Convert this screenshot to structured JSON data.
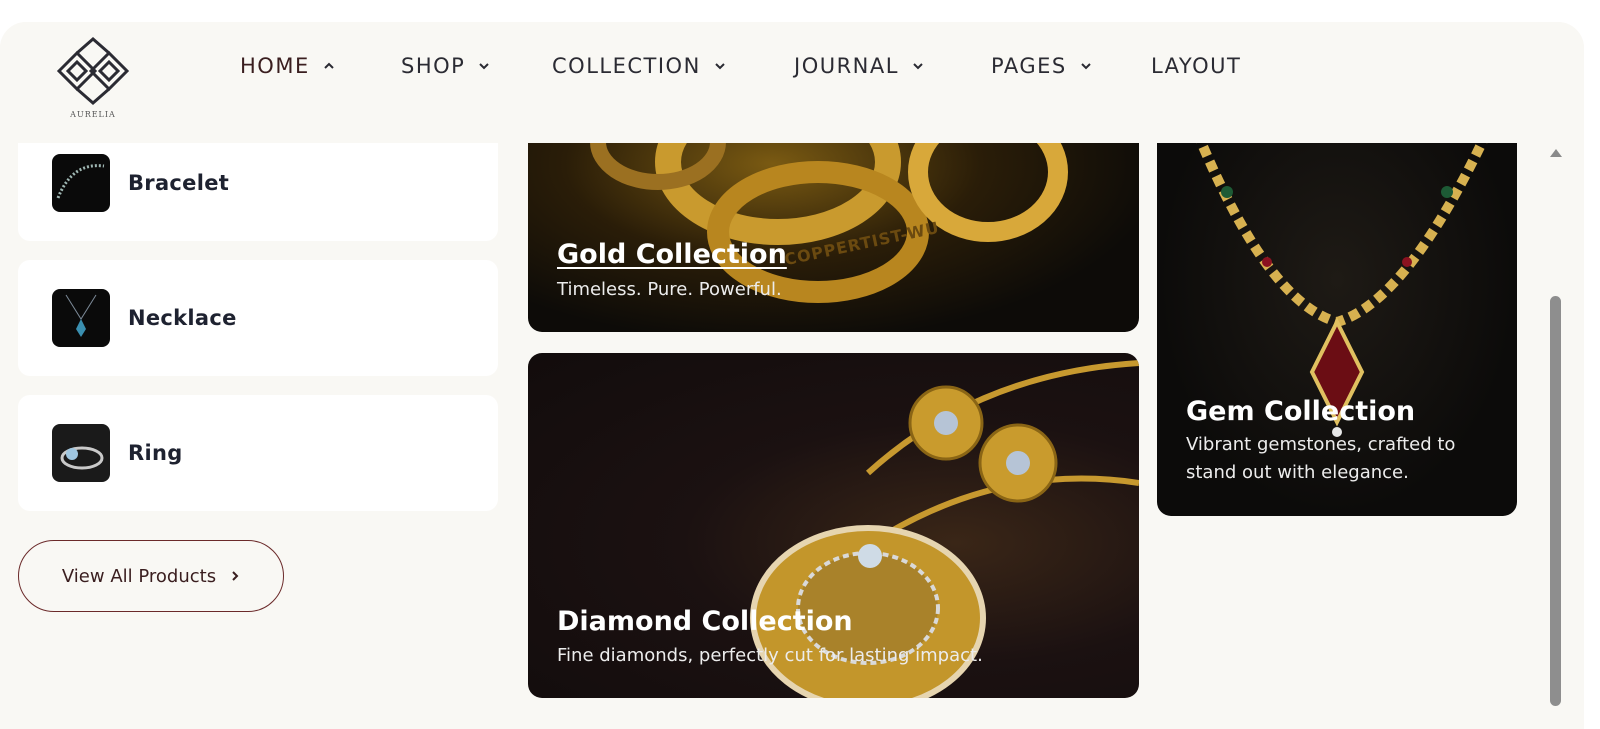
{
  "brand": {
    "logo_text": "AURELIA"
  },
  "nav": {
    "items": [
      {
        "label": "HOME",
        "chevron": "up"
      },
      {
        "label": "SHOP",
        "chevron": "down"
      },
      {
        "label": "COLLECTION",
        "chevron": "down"
      },
      {
        "label": "JOURNAL",
        "chevron": "down"
      },
      {
        "label": "PAGES",
        "chevron": "down"
      },
      {
        "label": "LAYOUT",
        "chevron": ""
      }
    ]
  },
  "categories": [
    {
      "label": "Bracelet",
      "icon": "bracelet-thumbnail"
    },
    {
      "label": "Necklace",
      "icon": "necklace-thumbnail"
    },
    {
      "label": "Ring",
      "icon": "ring-thumbnail"
    }
  ],
  "view_all": {
    "label": "View All Products",
    "icon": "chevron-right-icon"
  },
  "collections": {
    "gold": {
      "title": "Gold Collection",
      "subtitle": "Timeless. Pure. Powerful.",
      "engraving": "COPPERTIST-WU"
    },
    "diamond": {
      "title": "Diamond Collection",
      "subtitle": "Fine diamonds, perfectly cut for lasting impact."
    },
    "gem": {
      "title": "Gem Collection",
      "subtitle": "Vibrant gemstones, crafted to stand out with elegance."
    }
  },
  "colors": {
    "background": "#f9f8f4",
    "accent": "#6b2a2a",
    "text_dark": "#1e2230",
    "card_bg": "#ffffff"
  }
}
